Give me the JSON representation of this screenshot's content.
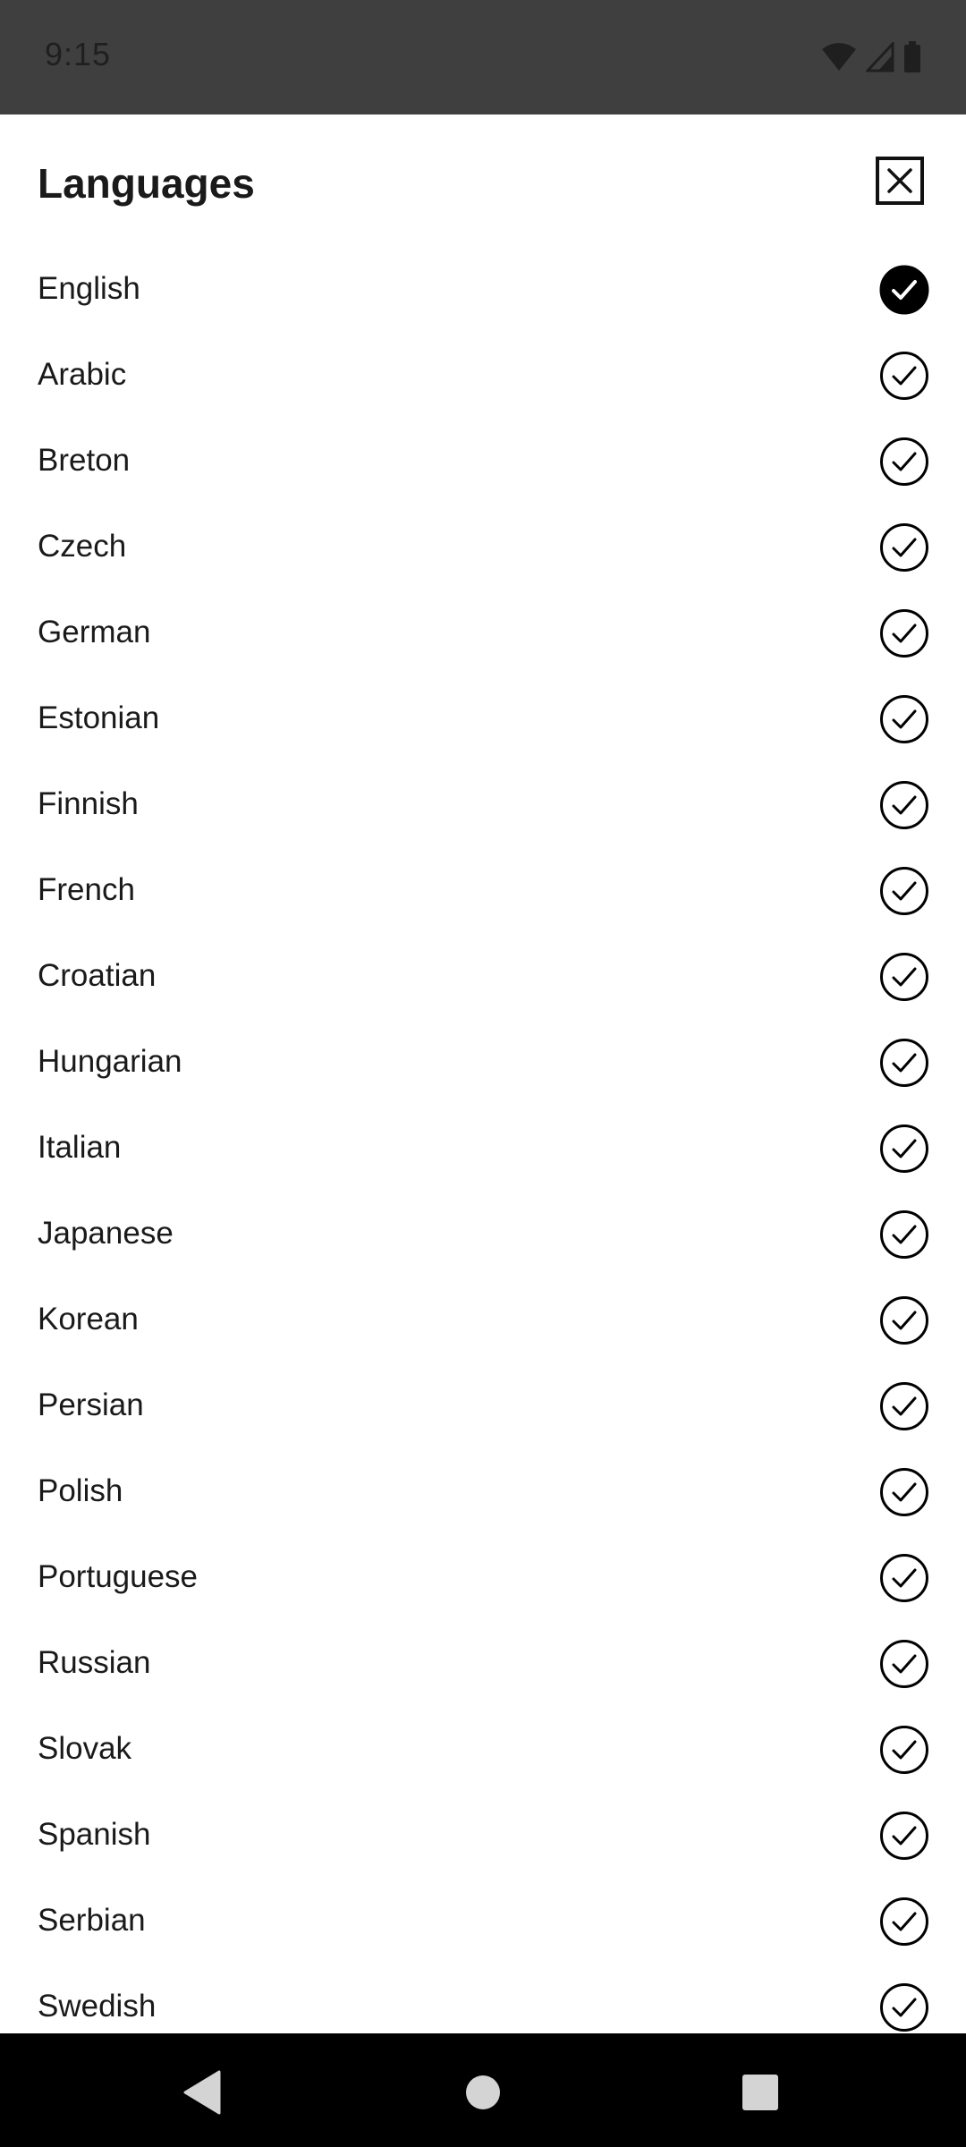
{
  "status_bar": {
    "time": "9:15",
    "icons": [
      "wifi-icon",
      "signal-icon",
      "battery-icon"
    ],
    "background": "#3f3f3f"
  },
  "sheet": {
    "title": "Languages",
    "close_icon": "close-icon"
  },
  "languages": [
    {
      "label": "English",
      "selected": true
    },
    {
      "label": "Arabic",
      "selected": false
    },
    {
      "label": "Breton",
      "selected": false
    },
    {
      "label": "Czech",
      "selected": false
    },
    {
      "label": "German",
      "selected": false
    },
    {
      "label": "Estonian",
      "selected": false
    },
    {
      "label": "Finnish",
      "selected": false
    },
    {
      "label": "French",
      "selected": false
    },
    {
      "label": "Croatian",
      "selected": false
    },
    {
      "label": "Hungarian",
      "selected": false
    },
    {
      "label": "Italian",
      "selected": false
    },
    {
      "label": "Japanese",
      "selected": false
    },
    {
      "label": "Korean",
      "selected": false
    },
    {
      "label": "Persian",
      "selected": false
    },
    {
      "label": "Polish",
      "selected": false
    },
    {
      "label": "Portuguese",
      "selected": false
    },
    {
      "label": "Russian",
      "selected": false
    },
    {
      "label": "Slovak",
      "selected": false
    },
    {
      "label": "Spanish",
      "selected": false
    },
    {
      "label": "Serbian",
      "selected": false
    },
    {
      "label": "Swedish",
      "selected": false
    }
  ],
  "nav_bar": {
    "buttons": [
      "back-icon",
      "home-icon",
      "recents-icon"
    ],
    "background": "#000000"
  }
}
